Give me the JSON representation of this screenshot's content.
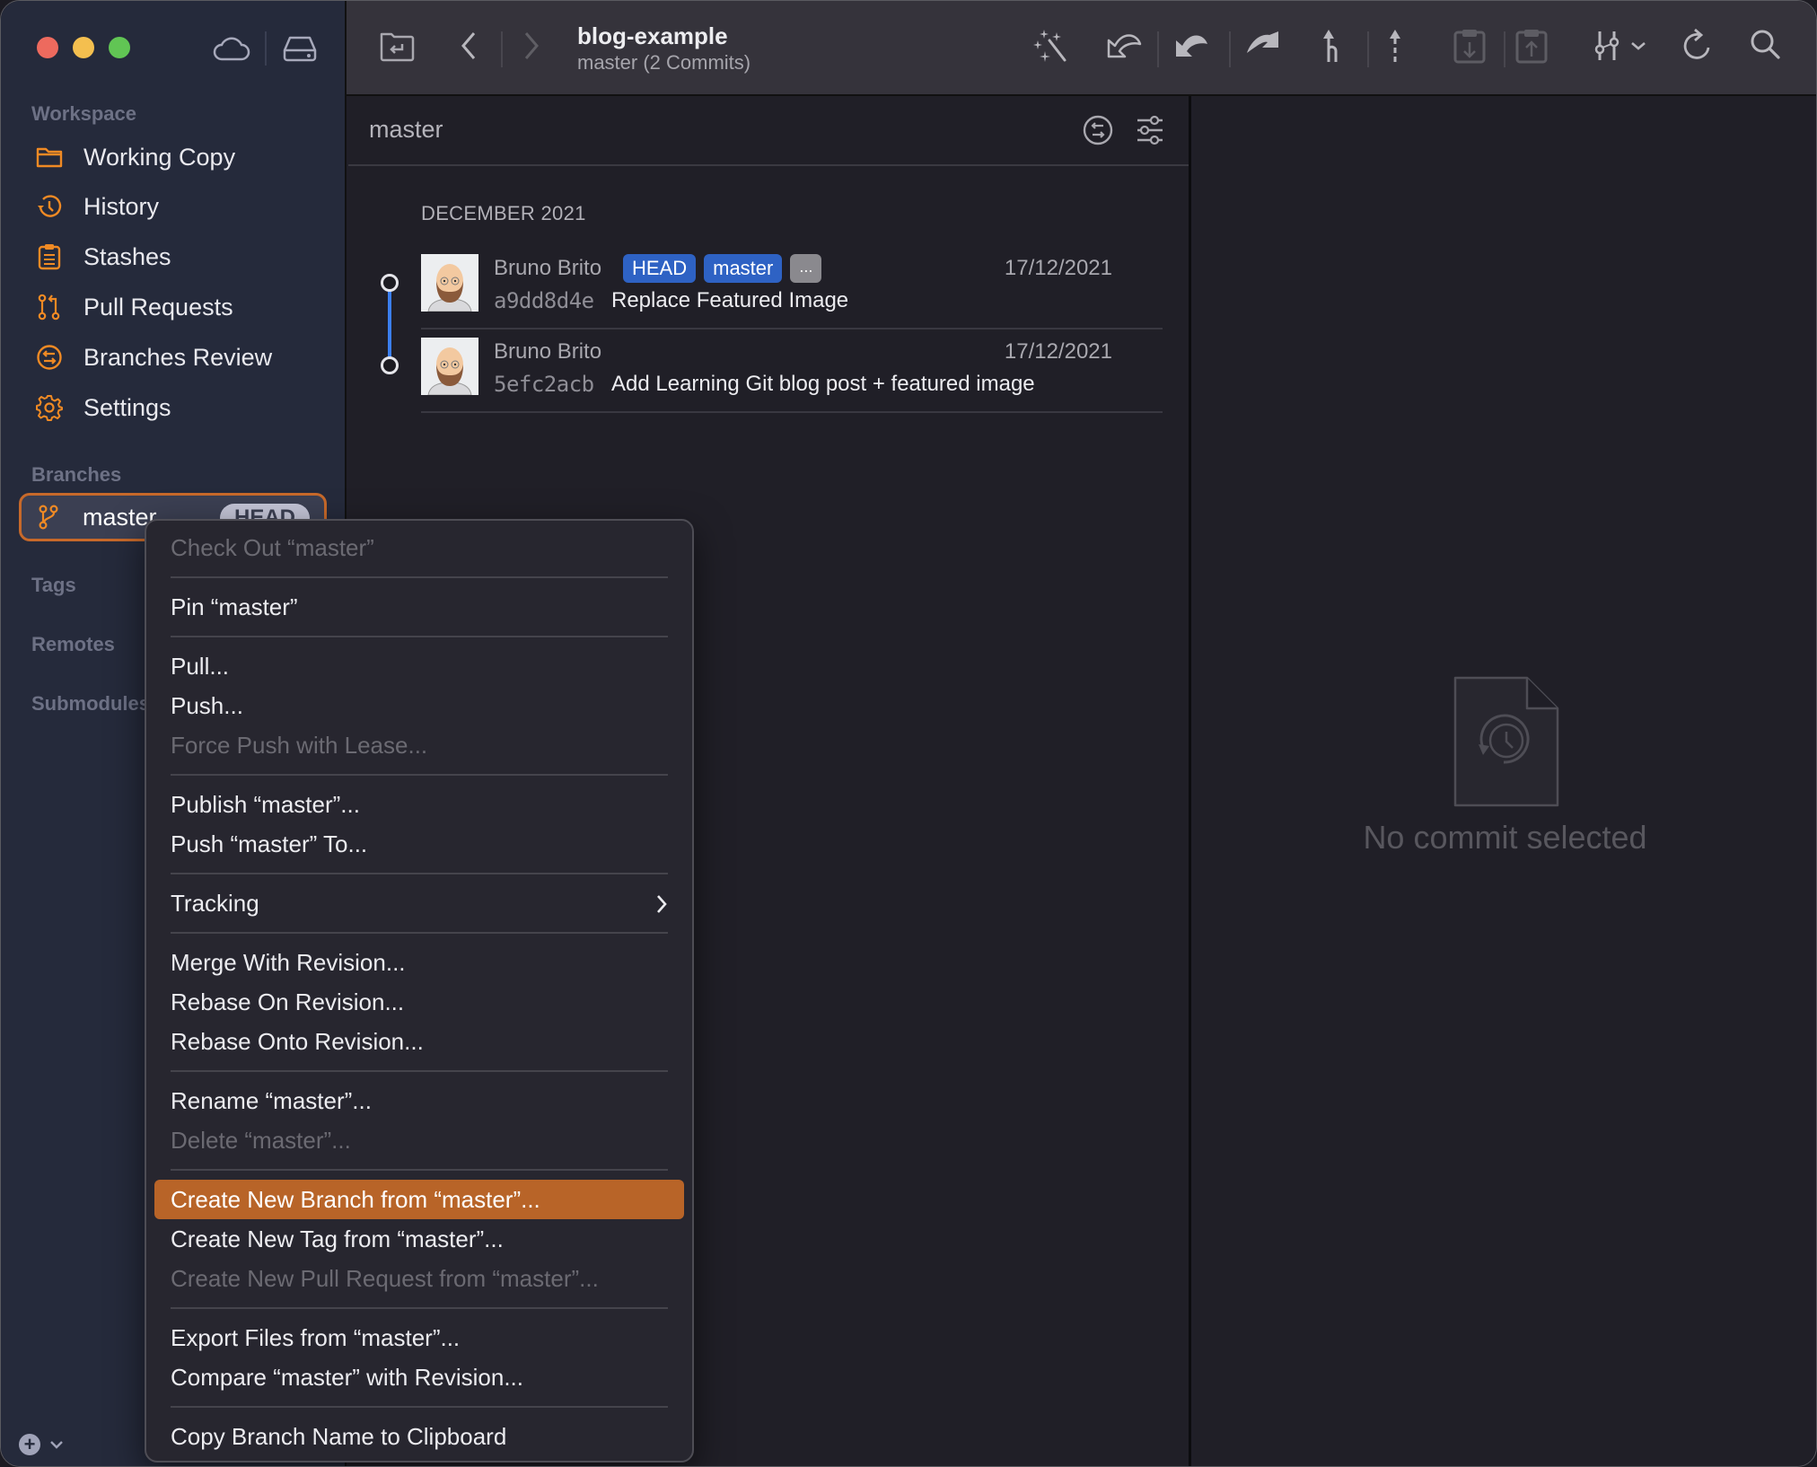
{
  "window": {
    "title": "blog-example",
    "subtitle": "master (2 Commits)"
  },
  "sidebar": {
    "sections": {
      "workspace": "Workspace",
      "branches": "Branches",
      "tags": "Tags",
      "remotes": "Remotes",
      "submodules": "Submodules"
    },
    "items": [
      {
        "label": "Working Copy",
        "icon": "folder-icon"
      },
      {
        "label": "History",
        "icon": "history-icon"
      },
      {
        "label": "Stashes",
        "icon": "clipboard-icon"
      },
      {
        "label": "Pull Requests",
        "icon": "pull-request-icon"
      },
      {
        "label": "Branches Review",
        "icon": "branches-review-icon"
      },
      {
        "label": "Settings",
        "icon": "gear-icon"
      }
    ],
    "branch": {
      "name": "master",
      "badge": "HEAD"
    },
    "accent": "#c7692a"
  },
  "toolbar": {
    "buttons": [
      "open-repo",
      "back",
      "forward",
      "magic-wand",
      "undo",
      "fetch",
      "push-arrow",
      "pull-branch",
      "push",
      "stash",
      "pop-stash",
      "filter",
      "refresh",
      "search"
    ]
  },
  "history": {
    "branch": "master",
    "month": "DECEMBER 2021",
    "commits": [
      {
        "author": "Bruno Brito",
        "hash": "a9dd8d4e",
        "message": "Replace Featured Image",
        "date": "17/12/2021",
        "tags": [
          "HEAD",
          "master",
          "..."
        ]
      },
      {
        "author": "Bruno Brito",
        "hash": "5efc2acb",
        "message": "Add Learning Git blog post + featured image",
        "date": "17/12/2021",
        "tags": []
      }
    ]
  },
  "detail": {
    "empty_text": "No commit selected"
  },
  "context_menu": {
    "groups": [
      [
        {
          "label": "Check Out “master”",
          "disabled": true
        }
      ],
      [
        {
          "label": "Pin “master”"
        }
      ],
      [
        {
          "label": "Pull..."
        },
        {
          "label": "Push..."
        },
        {
          "label": "Force Push with Lease...",
          "disabled": true
        }
      ],
      [
        {
          "label": "Publish “master”..."
        },
        {
          "label": "Push “master” To..."
        }
      ],
      [
        {
          "label": "Tracking",
          "submenu": true
        }
      ],
      [
        {
          "label": "Merge With Revision..."
        },
        {
          "label": "Rebase On Revision..."
        },
        {
          "label": "Rebase Onto Revision..."
        }
      ],
      [
        {
          "label": "Rename “master”..."
        },
        {
          "label": "Delete “master”...",
          "disabled": true
        }
      ],
      [
        {
          "label": "Create New Branch from “master”...",
          "highlighted": true
        },
        {
          "label": "Create New Tag from “master”..."
        },
        {
          "label": "Create New Pull Request from “master”...",
          "disabled": true
        }
      ],
      [
        {
          "label": "Export Files from “master”..."
        },
        {
          "label": "Compare “master” with Revision..."
        }
      ],
      [
        {
          "label": "Copy Branch Name to Clipboard"
        }
      ]
    ],
    "highlight_color": "#b86428"
  }
}
